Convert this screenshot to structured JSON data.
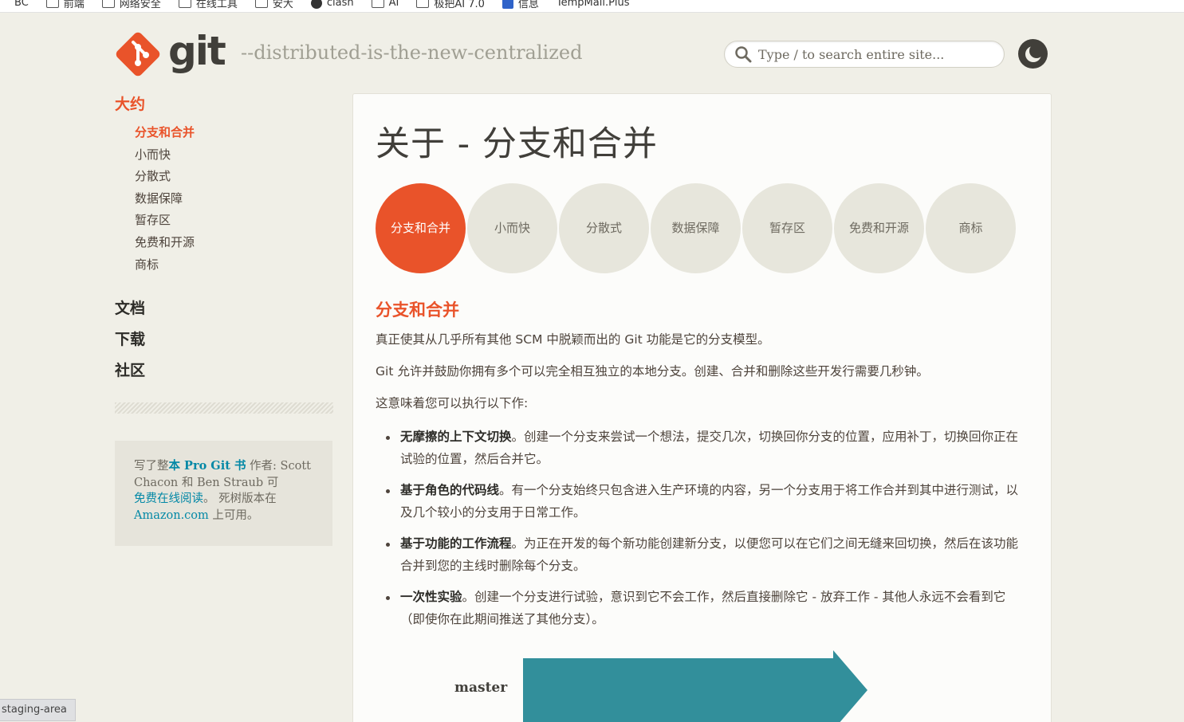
{
  "bookmarks": [
    "BC",
    "前端",
    "网络安全",
    "在线工具",
    "安大",
    "clash",
    "AI",
    "极把AI 7.0",
    "信息",
    "TempMail.Plus"
  ],
  "header": {
    "logo_text": "git",
    "tagline": "--distributed-is-the-new-centralized",
    "search_placeholder": "Type / to search entire site..."
  },
  "sidebar": {
    "section_about": "大约",
    "about_items": [
      {
        "label": "分支和合并",
        "active": true
      },
      {
        "label": "小而快"
      },
      {
        "label": "分散式"
      },
      {
        "label": "数据保障"
      },
      {
        "label": "暂存区"
      },
      {
        "label": "免费和开源"
      },
      {
        "label": "商标"
      }
    ],
    "section_docs": "文档",
    "section_downloads": "下载",
    "section_community": "社区",
    "book": {
      "prefix": "写了整",
      "link": "本 Pro Git 书",
      "after_link": " 作者: Scott Chacon 和 Ben Straub 可",
      "read_link": "免费在线阅读",
      "mid": "。 死树版本在",
      "amazon_link": "Amazon.com",
      "suffix": " 上可用。"
    }
  },
  "main": {
    "title": "关于 - 分支和合并",
    "circles": [
      "分支和合并",
      "小而快",
      "分散式",
      "数据保障",
      "暂存区",
      "免费和开源",
      "商标"
    ],
    "section_title": "分支和合并",
    "para1": "真正使其从几乎所有其他 SCM 中脱颖而出的 Git 功能是它的分支模型。",
    "para2": "Git 允许并鼓励你拥有多个可以完全相互独立的本地分支。创建、合并和删除这些开发行需要几秒钟。",
    "para3": "这意味着您可以执行以下作:",
    "bullets": [
      {
        "bold": "无摩擦的上下文切换",
        "text": "。创建一个分支来尝试一个想法，提交几次，切换回你分支的位置，应用补丁，切换回你正在试验的位置，然后合并它。"
      },
      {
        "bold": "基于角色的代码线",
        "text": "。有一个分支始终只包含进入生产环境的内容，另一个分支用于将工作合并到其中进行测试，以及几个较小的分支用于日常工作。"
      },
      {
        "bold": "基于功能的工作流程",
        "text": "。为正在开发的每个新功能创建新分支，以便您可以在它们之间无缝来回切换，然后在该功能合并到您的主线时删除每个分支。"
      },
      {
        "bold": "一次性实验",
        "text": "。创建一个分支进行试验，意识到它不会工作，然后直接删除它 - 放弃工作 - 其他人永远不会看到它（即使你在此期间推送了其他分支）。"
      }
    ],
    "diagram_label": "master"
  },
  "status_bar": "staging-area",
  "colors": {
    "accent": "#e9532a",
    "teal": "#328f9b",
    "link": "#0388a6"
  }
}
